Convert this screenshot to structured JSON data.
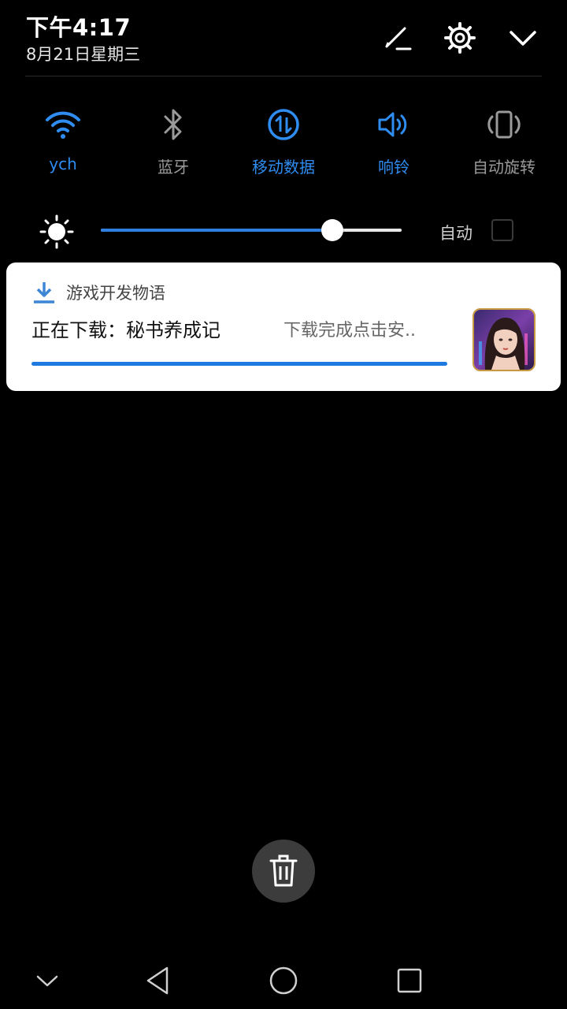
{
  "status": {
    "time": "下午4:17",
    "date": "8月21日星期三"
  },
  "header_icons": {
    "edit": "edit-pencil-icon",
    "settings": "gear-icon",
    "collapse": "chevron-down-icon"
  },
  "toggles": [
    {
      "label": "ych",
      "icon": "wifi-icon",
      "state": "on"
    },
    {
      "label": "蓝牙",
      "icon": "bluetooth-icon",
      "state": "off"
    },
    {
      "label": "移动数据",
      "icon": "mobile-data-icon",
      "state": "on"
    },
    {
      "label": "响铃",
      "icon": "speaker-icon",
      "state": "on"
    },
    {
      "label": "自动旋转",
      "icon": "auto-rotate-icon",
      "state": "off"
    }
  ],
  "brightness": {
    "level": 0.77,
    "auto_label": "自动",
    "auto_checked": false
  },
  "notification": {
    "app_name": "游戏开发物语",
    "title": "正在下载：秘书养成记",
    "subtitle": "下载完成点击安..",
    "progress": 1.0
  },
  "colors": {
    "accent": "#2f8cf0",
    "inactive": "#9a9a9a",
    "background": "#000000"
  },
  "navbar": {
    "icons": [
      "chevron-down-icon",
      "back-icon",
      "home-icon",
      "recents-icon"
    ]
  }
}
